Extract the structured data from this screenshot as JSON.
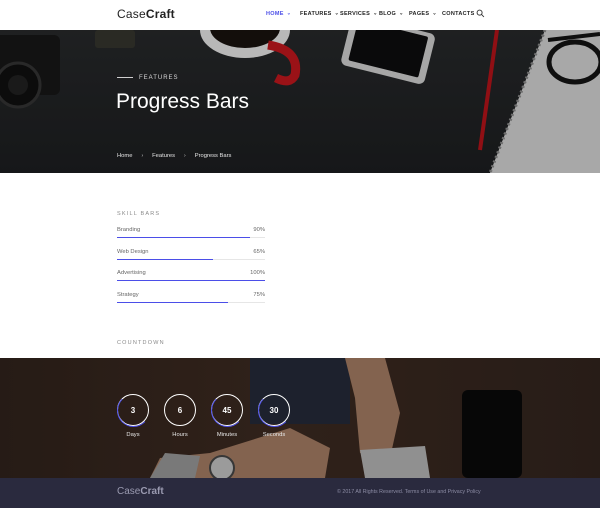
{
  "brand": {
    "name_light": "Case",
    "name_bold": "Craft"
  },
  "nav": {
    "items": [
      {
        "label": "HOME",
        "caret": true,
        "active": true
      },
      {
        "label": "FEATURES",
        "caret": true,
        "active": false
      },
      {
        "label": "SERVICES",
        "caret": true,
        "active": false
      },
      {
        "label": "BLOG",
        "caret": true,
        "active": false
      },
      {
        "label": "PAGES",
        "caret": true,
        "active": false
      },
      {
        "label": "CONTACTS",
        "caret": false,
        "active": false
      }
    ],
    "search_icon": "search-icon"
  },
  "hero": {
    "eyebrow": "FEATURES",
    "title": "Progress Bars",
    "breadcrumb": [
      "Home",
      "Features",
      "Progress Bars"
    ]
  },
  "skills": {
    "heading": "SKILL BARS",
    "items": [
      {
        "label": "Branding",
        "percent_text": "90%",
        "value": 0.9
      },
      {
        "label": "Web Design",
        "percent_text": "65%",
        "value": 0.65
      },
      {
        "label": "Advertising",
        "percent_text": "100%",
        "value": 1.0
      },
      {
        "label": "Strategy",
        "percent_text": "75%",
        "value": 0.75
      }
    ]
  },
  "countdown": {
    "heading": "COUNTDOWN",
    "items": [
      {
        "value": "3",
        "label": "Days"
      },
      {
        "value": "6",
        "label": "Hours"
      },
      {
        "value": "45",
        "label": "Minutes"
      },
      {
        "value": "30",
        "label": "Seconds"
      }
    ]
  },
  "footer": {
    "logo_light": "Case",
    "logo_bold": "Craft",
    "copyright": "© 2017 All Rights Reserved. Terms of Use and Privacy Policy"
  },
  "colors": {
    "accent": "#4b4ee8",
    "footer_bg": "#2a2a3e"
  }
}
